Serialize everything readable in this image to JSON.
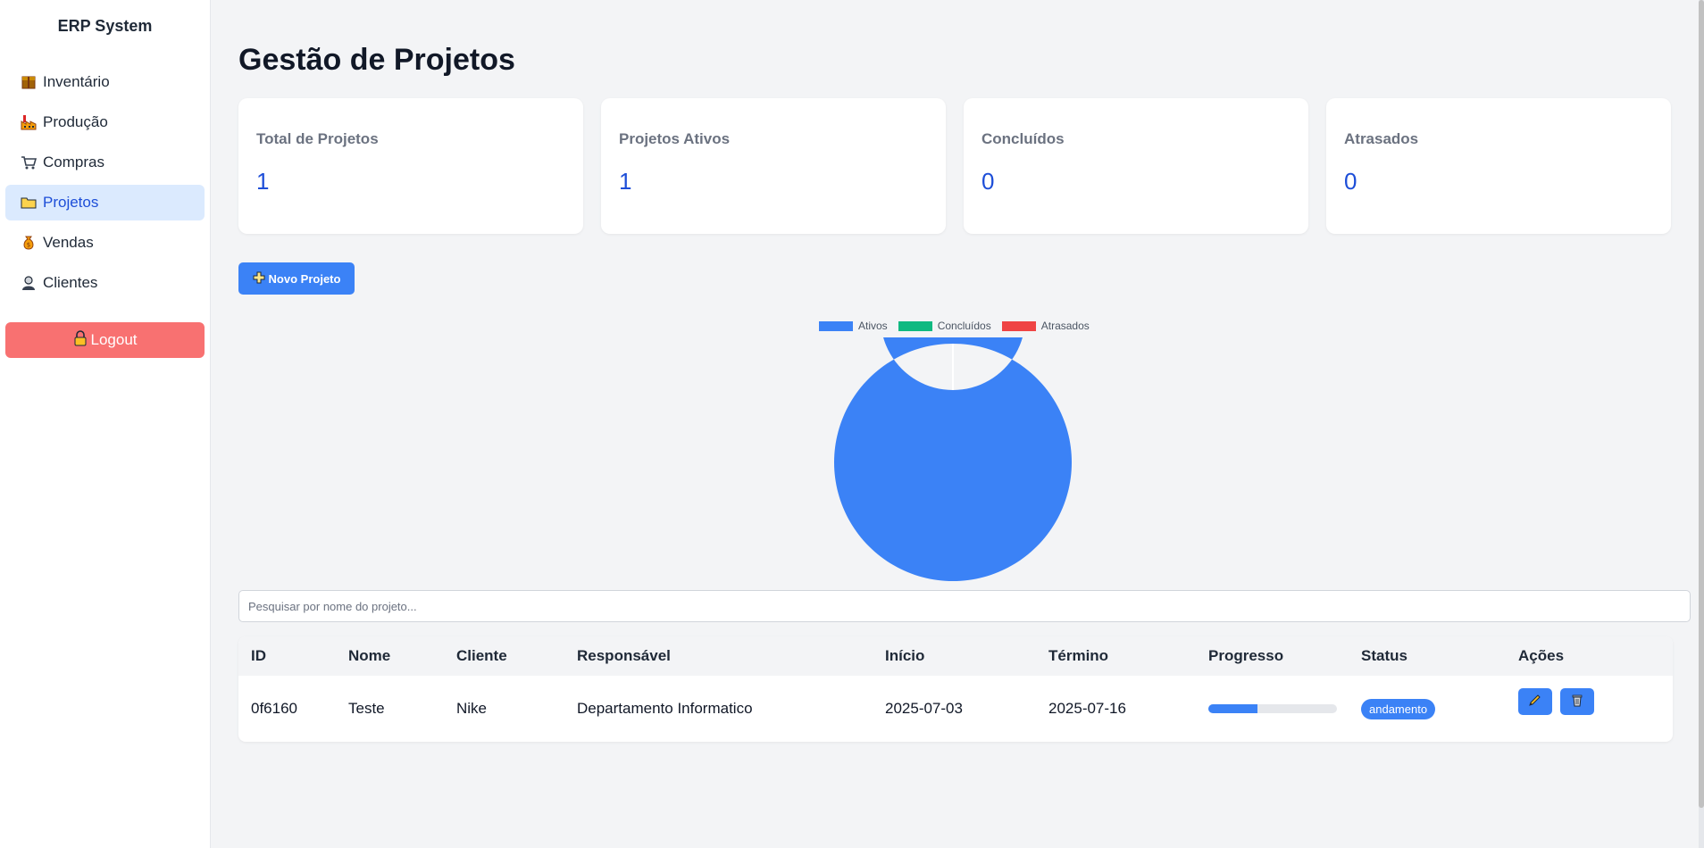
{
  "sidebar": {
    "brand": "ERP System",
    "items": [
      {
        "label": "Inventário",
        "icon": "package-icon"
      },
      {
        "label": "Produção",
        "icon": "factory-icon"
      },
      {
        "label": "Compras",
        "icon": "cart-icon"
      },
      {
        "label": "Projetos",
        "icon": "folder-icon",
        "active": true
      },
      {
        "label": "Vendas",
        "icon": "money-bag-icon"
      },
      {
        "label": "Clientes",
        "icon": "user-icon"
      }
    ],
    "logout_label": "Logout"
  },
  "main": {
    "title": "Gestão de Projetos",
    "cards": [
      {
        "label": "Total de Projetos",
        "value": "1"
      },
      {
        "label": "Projetos Ativos",
        "value": "1"
      },
      {
        "label": "Concluídos",
        "value": "0"
      },
      {
        "label": "Atrasados",
        "value": "0"
      }
    ],
    "new_button_label": "Novo Projeto",
    "search_placeholder": "Pesquisar por nome do projeto...",
    "table": {
      "headers": [
        "ID",
        "Nome",
        "Cliente",
        "Responsável",
        "Início",
        "Término",
        "Progresso",
        "Status",
        "Ações"
      ],
      "rows": [
        {
          "id": "0f6160",
          "nome": "Teste",
          "cliente": "Nike",
          "responsavel": "Departamento Informatico",
          "inicio": "2025-07-03",
          "termino": "2025-07-16",
          "progresso": 0.38,
          "status": "andamento"
        }
      ]
    }
  },
  "colors": {
    "accent": "#3b82f6",
    "ativos": "#3b82f6",
    "concluidos": "#10b981",
    "atrasados": "#ef4444",
    "logout": "#f87171"
  },
  "chart_data": {
    "type": "pie",
    "categories": [
      "Ativos",
      "Concluídos",
      "Atrasados"
    ],
    "values": [
      1,
      0,
      0
    ],
    "colors": [
      "#3b82f6",
      "#10b981",
      "#ef4444"
    ],
    "legend": "top",
    "donut": true
  }
}
